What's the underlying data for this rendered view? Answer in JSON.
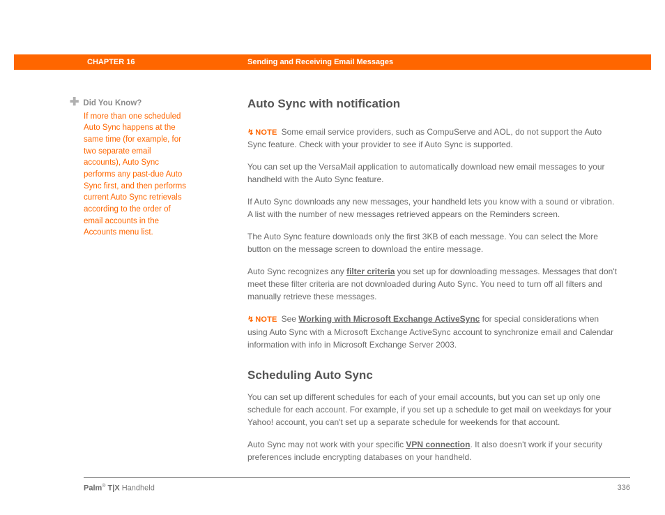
{
  "header": {
    "chapter_label": "CHAPTER 16",
    "chapter_title": "Sending and Receiving Email Messages"
  },
  "sidebar": {
    "icon": "✚",
    "title": "Did You Know?",
    "body": "If more than one scheduled Auto Sync happens at the same time (for example, for two separate email accounts), Auto Sync performs any past-due Auto Sync first, and then performs current Auto Sync retrievals according to the order of email accounts in the Accounts menu list."
  },
  "main": {
    "h1": "Auto Sync with notification",
    "note1_icon": "↯",
    "note1_label": "NOTE",
    "note1_text": "Some email service providers, such as CompuServe and AOL, do not support the Auto Sync feature. Check with your provider to see if Auto Sync is supported.",
    "p1": "You can set up the VersaMail application to automatically download new email messages to your handheld with the Auto Sync feature.",
    "p2": "If Auto Sync downloads any new messages, your handheld lets you know with a sound or vibration. A list with the number of new messages retrieved appears on the Reminders screen.",
    "p3": "The Auto Sync feature downloads only the first 3KB of each message. You can select the More button on the message screen to download the entire message.",
    "p4_a": "Auto Sync recognizes any ",
    "p4_link": "filter criteria",
    "p4_b": " you set up for downloading messages. Messages that don't meet these filter criteria are not downloaded during Auto Sync. You need to turn off all filters and manually retrieve these messages.",
    "note2_icon": "↯",
    "note2_label": "NOTE",
    "note2_a": "See ",
    "note2_link": "Working with Microsoft Exchange ActiveSync",
    "note2_b": " for special considerations when using Auto Sync with a Microsoft Exchange ActiveSync account to synchronize email and Calendar information with info in Microsoft Exchange Server 2003.",
    "h2": "Scheduling Auto Sync",
    "p5": "You can set up different schedules for each of your email accounts, but you can set up only one schedule for each account. For example, if you set up a schedule to get mail on weekdays for your Yahoo! account, you can't set up a separate schedule for weekends for that account.",
    "p6_a": "Auto Sync may not work with your specific ",
    "p6_link": "VPN connection",
    "p6_b": ". It also doesn't work if your security preferences include encrypting databases on your handheld."
  },
  "footer": {
    "brand_bold": "Palm",
    "brand_reg": "®",
    "brand_model": " T|X ",
    "brand_tail": "Handheld",
    "page_number": "336"
  }
}
